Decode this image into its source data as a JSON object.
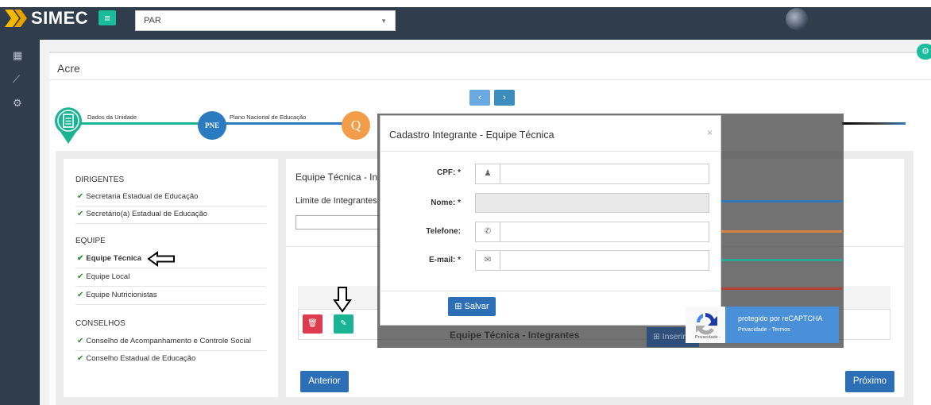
{
  "header": {
    "logo_text": "SIMEC",
    "menu_toggle_glyph": "≡",
    "program_select": "PAR",
    "user_avatar": "user-avatar"
  },
  "sidebar": {
    "icons": [
      "dashboard-icon",
      "chart-line-icon",
      "gears-icon"
    ]
  },
  "page": {
    "title": "Acre"
  },
  "wizard": {
    "prev_glyph": "‹",
    "next_glyph": "›",
    "steps": [
      {
        "label": "Dados da Unidade"
      },
      {
        "label": "Plano Nacional de Educação",
        "circle_text": "PNE"
      },
      {
        "label": "Q",
        "circle_text": "Q"
      }
    ]
  },
  "menu": {
    "sections": [
      {
        "title": "DIRIGENTES",
        "items": [
          "Secretaria Estadual de Educação",
          "Secretário(a) Estadual de Educação"
        ]
      },
      {
        "title": "EQUIPE",
        "items": [
          "Equipe Técnica",
          "Equipe Local",
          "Equipe Nutricionistas"
        ]
      },
      {
        "title": "CONSELHOS",
        "items": [
          "Conselho de Acompanhamento e Controle Social",
          "Conselho Estadual de Educação"
        ]
      }
    ]
  },
  "content": {
    "panel_title": "Equipe Técnica - In",
    "limit_label": "Limite de Integrantes",
    "prev_button": "Anterior",
    "next_button": "Próximo",
    "underlay_title": "Equipe Técnica - Integrantes",
    "underlay_button": "⊞ Inserir"
  },
  "modal": {
    "title": "Cadastro Integrante - Equipe Técnica",
    "close_glyph": "×",
    "fields": {
      "cpf": {
        "label": "CPF: *",
        "value": ""
      },
      "nome": {
        "label": "Nome: *",
        "value": ""
      },
      "telefone": {
        "label": "Telefone:",
        "value": ""
      },
      "email": {
        "label": "E-mail: *",
        "value": ""
      }
    },
    "save_button": "⊞ Salvar"
  },
  "recaptcha": {
    "line1": "protegido por reCAPTCHA",
    "line2": "Privacidade - Termos",
    "small": "Privacidade -"
  },
  "colors": {
    "topbar": "#2f3d4c",
    "accent_green": "#1abc9c",
    "primary_blue": "#2d6fb7",
    "danger": "#dd3c4f"
  }
}
